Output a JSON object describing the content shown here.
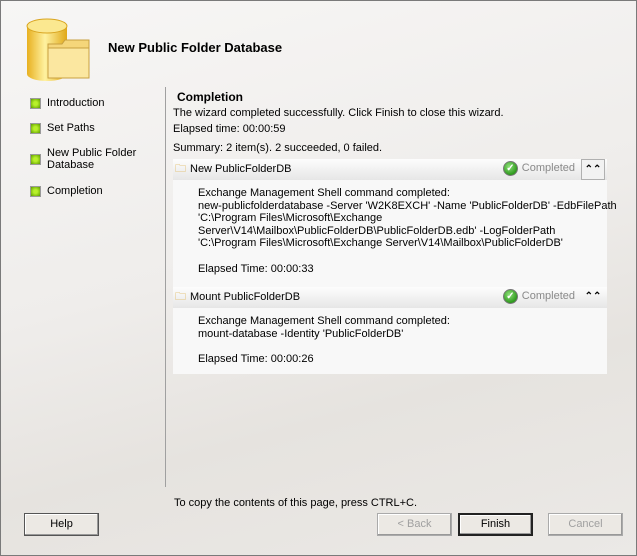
{
  "title": "New Public Folder Database",
  "nav": [
    "Introduction",
    "Set Paths",
    "New Public Folder Database",
    "Completion"
  ],
  "content": {
    "heading": "Completion",
    "message": "The wizard completed successfully. Click Finish to close this wizard.",
    "elapsed": "Elapsed time: 00:00:59",
    "summary": "Summary: 2 item(s). 2 succeeded, 0 failed.",
    "tasks": [
      {
        "name": "New PublicFolderDB",
        "status": "Completed",
        "lines": [
          "Exchange Management Shell command completed:",
          "new-publicfolderdatabase -Server 'W2K8EXCH' -Name 'PublicFolderDB' -EdbFilePath",
          "'C:\\Program Files\\Microsoft\\Exchange",
          "Server\\V14\\Mailbox\\PublicFolderDB\\PublicFolderDB.edb' -LogFolderPath",
          "'C:\\Program Files\\Microsoft\\Exchange Server\\V14\\Mailbox\\PublicFolderDB'"
        ],
        "elapsed": "Elapsed Time: 00:00:33"
      },
      {
        "name": "Mount PublicFolderDB",
        "status": "Completed",
        "lines": [
          "Exchange Management Shell command completed:",
          "mount-database -Identity 'PublicFolderDB'"
        ],
        "elapsed": "Elapsed Time: 00:00:26"
      }
    ],
    "copy_hint": "To copy the contents of this page, press CTRL+C."
  },
  "buttons": {
    "help": "Help",
    "back": "< Back",
    "finish": "Finish",
    "cancel": "Cancel"
  },
  "icons": {
    "collapse": "⌃⌃",
    "check": "✓"
  }
}
